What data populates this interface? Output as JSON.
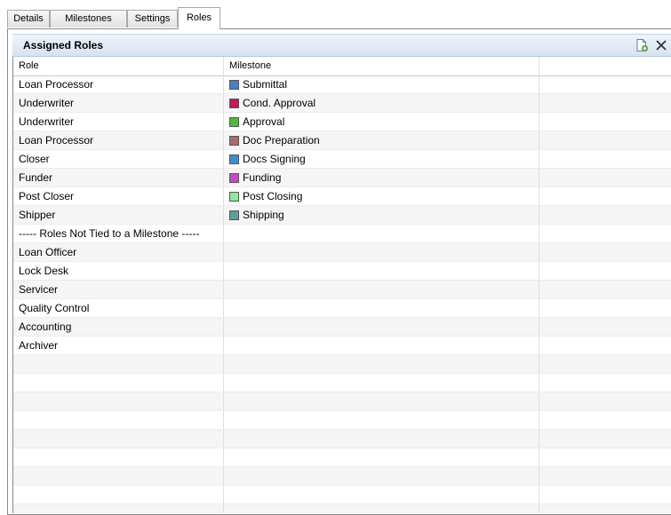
{
  "tabs": [
    {
      "label": "Details",
      "active": false
    },
    {
      "label": "Milestones",
      "active": false
    },
    {
      "label": "Settings",
      "active": false
    },
    {
      "label": "Roles",
      "active": true
    }
  ],
  "panel": {
    "title": "Assigned Roles",
    "new_icon": "new-document-icon",
    "delete_icon": "delete-x-icon"
  },
  "columns": [
    "Role",
    "Milestone",
    ""
  ],
  "rows": [
    {
      "role": "Loan Processor",
      "milestone": "Submittal",
      "color": "#4a7fc1"
    },
    {
      "role": "Underwriter",
      "milestone": "Cond. Approval",
      "color": "#c0185a"
    },
    {
      "role": "Underwriter",
      "milestone": "Approval",
      "color": "#4fb83c"
    },
    {
      "role": "Loan Processor",
      "milestone": "Doc Preparation",
      "color": "#a86a6a"
    },
    {
      "role": "Closer",
      "milestone": "Docs Signing",
      "color": "#3f8fca"
    },
    {
      "role": "Funder",
      "milestone": "Funding",
      "color": "#c04ac8"
    },
    {
      "role": "Post Closer",
      "milestone": "Post Closing",
      "color": "#8fe89a"
    },
    {
      "role": "Shipper",
      "milestone": "Shipping",
      "color": "#5fa09a"
    },
    {
      "role": "----- Roles Not Tied to a Milestone -----",
      "milestone": "",
      "color": ""
    },
    {
      "role": "Loan Officer",
      "milestone": "",
      "color": ""
    },
    {
      "role": "Lock Desk",
      "milestone": "",
      "color": ""
    },
    {
      "role": "Servicer",
      "milestone": "",
      "color": ""
    },
    {
      "role": "Quality Control",
      "milestone": "",
      "color": ""
    },
    {
      "role": "Accounting",
      "milestone": "",
      "color": ""
    },
    {
      "role": "Archiver",
      "milestone": "",
      "color": ""
    },
    {
      "role": "",
      "milestone": "",
      "color": ""
    },
    {
      "role": "",
      "milestone": "",
      "color": ""
    },
    {
      "role": "",
      "milestone": "",
      "color": ""
    },
    {
      "role": "",
      "milestone": "",
      "color": ""
    },
    {
      "role": "",
      "milestone": "",
      "color": ""
    },
    {
      "role": "",
      "milestone": "",
      "color": ""
    },
    {
      "role": "",
      "milestone": "",
      "color": ""
    },
    {
      "role": "",
      "milestone": "",
      "color": ""
    },
    {
      "role": "",
      "milestone": "",
      "color": ""
    }
  ]
}
